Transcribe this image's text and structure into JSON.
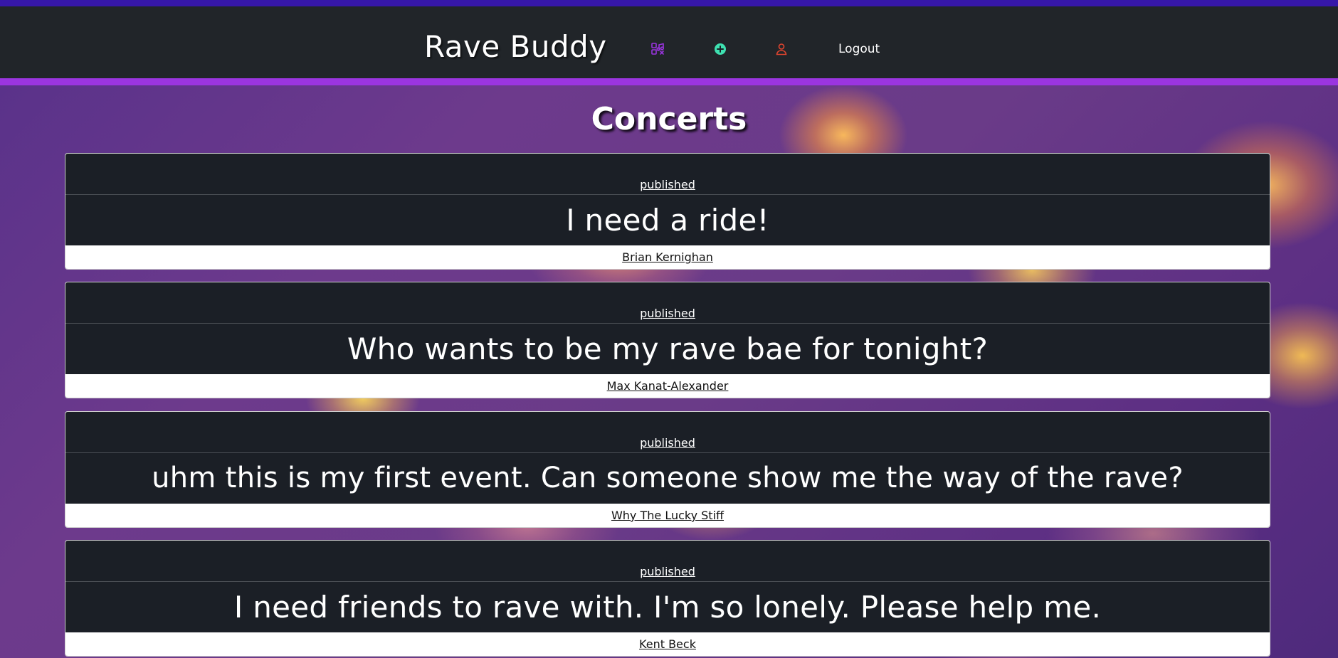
{
  "app": {
    "brand": "Rave Buddy",
    "logout_label": "Logout"
  },
  "nav": {
    "icons": [
      {
        "name": "music-icon",
        "color": "#9b35e0"
      },
      {
        "name": "plus-circle-icon",
        "color": "#3ee0b0"
      },
      {
        "name": "user-icon",
        "color": "#e0452f"
      }
    ]
  },
  "colors": {
    "top_strip": "#3617a8",
    "navbar_bg": "#212529",
    "nav_accent": "#9b35e0",
    "card_bg": "#1b1f26"
  },
  "page": {
    "title": "Concerts"
  },
  "posts": [
    {
      "status": "published",
      "title": "I need a ride!",
      "author": "Brian Kernighan"
    },
    {
      "status": "published",
      "title": "Who wants to be my rave bae for tonight?",
      "author": "Max Kanat-Alexander"
    },
    {
      "status": "published",
      "title": "uhm this is my first event. Can someone show me the way of the rave?",
      "author": "Why The Lucky Stiff"
    },
    {
      "status": "published",
      "title": "I need friends to rave with. I'm so lonely. Please help me.",
      "author": "Kent Beck"
    }
  ]
}
